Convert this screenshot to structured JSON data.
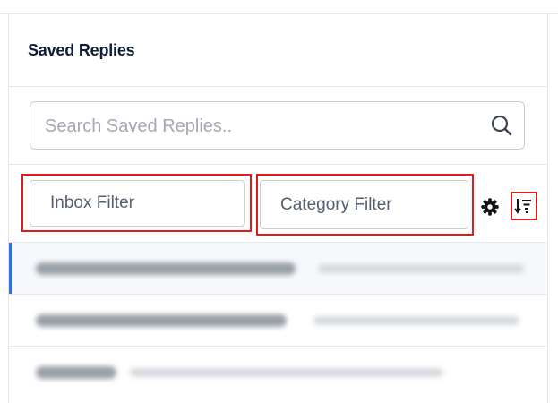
{
  "panel": {
    "title": "Saved Replies"
  },
  "search": {
    "placeholder": "Search Saved Replies..",
    "value": "",
    "icon": "search-icon"
  },
  "filters": {
    "inbox_filter_label": "Inbox Filter",
    "category_filter_label": "Category Filter",
    "settings_icon": "gear-icon",
    "sort_icon": "sort-descending-icon"
  },
  "list": {
    "items": [
      {
        "content": "redacted",
        "active": true
      },
      {
        "content": "redacted",
        "active": false
      },
      {
        "content": "redacted",
        "active": false
      }
    ]
  },
  "colors": {
    "highlight": "#e01b1b",
    "active_indicator": "#2f6fe6",
    "title_text": "#0f1d3a"
  }
}
